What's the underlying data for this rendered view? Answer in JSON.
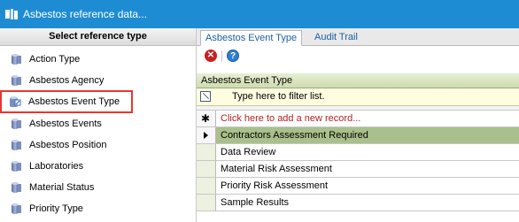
{
  "window": {
    "title": "Asbestos reference data..."
  },
  "left_panel": {
    "header": "Select reference type",
    "items": [
      {
        "label": "Action Type",
        "selected": false
      },
      {
        "label": "Asbestos Agency",
        "selected": false
      },
      {
        "label": "Asbestos Event Type",
        "selected": true
      },
      {
        "label": "Asbestos Events",
        "selected": false
      },
      {
        "label": "Asbestos Position",
        "selected": false
      },
      {
        "label": "Laboratories",
        "selected": false
      },
      {
        "label": "Material Status",
        "selected": false
      },
      {
        "label": "Priority Type",
        "selected": false
      }
    ]
  },
  "tabs": [
    {
      "label": "Asbestos Event Type",
      "active": true
    },
    {
      "label": "Audit Trail",
      "active": false
    }
  ],
  "toolbar": {
    "delete_icon": "delete-icon",
    "help_icon": "help-icon"
  },
  "grid": {
    "column_header": "Asbestos Event Type",
    "filter_placeholder": "Type here to filter list.",
    "add_row_text": "Click here to add a new record...",
    "rows": [
      "Contractors Assessment Required",
      "Data Review",
      "Material Risk Assessment",
      "Priority Risk Assessment",
      "Sample Results"
    ],
    "current_row_index": 0
  },
  "colors": {
    "titlebar": "#1e8cd3",
    "selected_row": "#a9c08a",
    "highlight_outline": "#e8362f"
  }
}
